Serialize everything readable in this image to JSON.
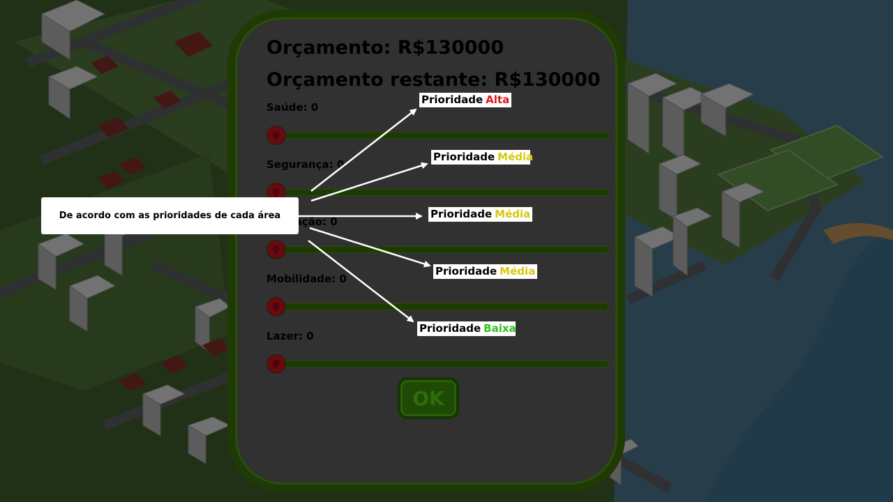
{
  "budget": {
    "total": "Orçamento: R$130000",
    "remaining": "Orçamento restante: R$130000"
  },
  "categories": [
    {
      "label": "Saúde: 0",
      "value": 0
    },
    {
      "label": "Segurança: 0",
      "value": 0
    },
    {
      "label": "Educação: 0",
      "value": 0
    },
    {
      "label": "Mobilidade: 0",
      "value": 0
    },
    {
      "label": "Lazer: 0",
      "value": 0
    }
  ],
  "ok_label": "OK",
  "tutorial": {
    "callout": "De acordo com as prioridades de cada área",
    "priorities": [
      {
        "prefix": "Prioridade",
        "level": "Alta",
        "color": "#e0161b"
      },
      {
        "prefix": "Prioridade",
        "level": "Média",
        "color": "#d7c80e"
      },
      {
        "prefix": "Prioridade",
        "level": "Média",
        "color": "#d7c80e"
      },
      {
        "prefix": "Prioridade",
        "level": "Média",
        "color": "#d7c80e"
      },
      {
        "prefix": "Prioridade",
        "level": "Baixa",
        "color": "#2fc21a"
      }
    ]
  },
  "colors": {
    "panel_border": "#1f3a05",
    "slider_track": "#1c3a03",
    "knob": "#7a0b12"
  }
}
